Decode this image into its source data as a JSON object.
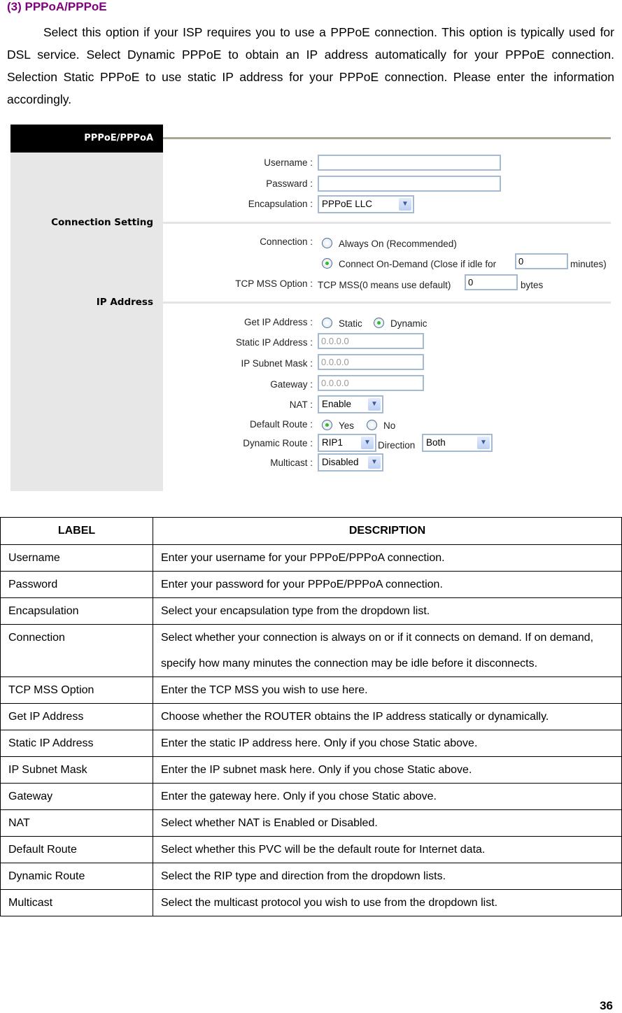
{
  "heading": "(3) PPPoA/PPPoE",
  "paragraph": "Select this option if your ISP requires you to use a PPPoE connection. This option is typically used for DSL service. Select Dynamic PPPoE to obtain an IP address automatically for your PPPoE connection. Selection Static PPPoE to use static IP address for your PPPoE connection. Please enter the information accordingly.",
  "colors": {
    "heading": "#800080",
    "title_bar": "#000000",
    "sidebar": "#e7e7e7",
    "radio_selected": "#2ebc2e",
    "input_border": "#a5b9d1"
  },
  "screenshot": {
    "title": "PPPoE/PPPoA",
    "sections": {
      "connection_setting": "Connection Setting",
      "ip_address": "IP Address"
    },
    "username": {
      "label": "Username :",
      "value": ""
    },
    "password": {
      "label": "Passward :",
      "value": ""
    },
    "encapsulation": {
      "label": "Encapsulation :",
      "value": "PPPoE LLC"
    },
    "connection": {
      "label": "Connection :",
      "options": [
        "Always On (Recommended)",
        "Connect On-Demand (Close if idle for"
      ],
      "selected": "Connect On-Demand (Close if idle for",
      "idle_value": "0",
      "idle_unit": "minutes)"
    },
    "tcp_mss": {
      "label": "TCP MSS Option :",
      "prefix": "TCP MSS(0 means use default)",
      "value": "0",
      "unit": "bytes"
    },
    "get_ip": {
      "label": "Get IP Address :",
      "options": [
        "Static",
        "Dynamic"
      ],
      "selected": "Dynamic"
    },
    "static_ip": {
      "label": "Static IP Address :",
      "value": "0.0.0.0"
    },
    "subnet_mask": {
      "label": "IP Subnet Mask :",
      "value": "0.0.0.0"
    },
    "gateway": {
      "label": "Gateway :",
      "value": "0.0.0.0"
    },
    "nat": {
      "label": "NAT :",
      "value": "Enable"
    },
    "default_route": {
      "label": "Default Route :",
      "options": [
        "Yes",
        "No"
      ],
      "selected": "Yes"
    },
    "dynamic_route": {
      "label": "Dynamic Route :",
      "value": "RIP1",
      "direction_label": "Direction",
      "direction_value": "Both"
    },
    "multicast": {
      "label": "Multicast :",
      "value": "Disabled"
    }
  },
  "table": {
    "headers": [
      "LABEL",
      "DESCRIPTION"
    ],
    "rows": [
      [
        "Username",
        "Enter your username for your PPPoE/PPPoA connection."
      ],
      [
        "Password",
        "Enter your password for your PPPoE/PPPoA connection."
      ],
      [
        "Encapsulation",
        "Select your encapsulation type from the dropdown list."
      ],
      [
        "Connection",
        "Select whether your connection is always on or if it connects on demand. If on demand, specify how many minutes the connection may be idle before it disconnects."
      ],
      [
        "TCP MSS Option",
        "Enter the TCP MSS you wish to use here."
      ],
      [
        "Get IP Address",
        "Choose whether the ROUTER obtains the IP address statically or dynamically."
      ],
      [
        "Static IP Address",
        "Enter the static IP address here. Only if you chose Static above."
      ],
      [
        "IP Subnet Mask",
        "Enter the IP subnet mask here. Only if you chose Static above."
      ],
      [
        "Gateway",
        "Enter the gateway here. Only if you chose Static above."
      ],
      [
        "NAT",
        "Select whether NAT is Enabled or Disabled."
      ],
      [
        "Default Route",
        "Select whether this PVC will be the default route for Internet data."
      ],
      [
        "Dynamic Route",
        "Select the RIP type and direction from the dropdown lists."
      ],
      [
        "Multicast",
        "Select the multicast protocol you wish to use from the dropdown list."
      ]
    ]
  },
  "page_number": "36"
}
